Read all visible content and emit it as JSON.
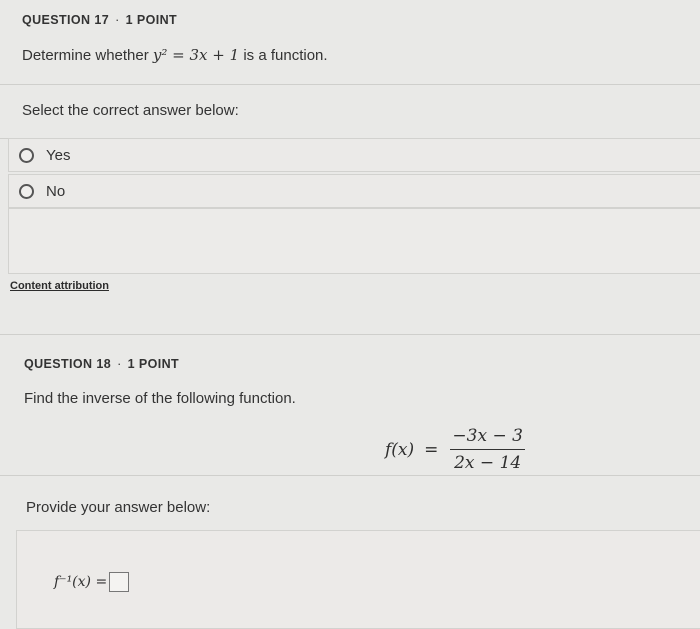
{
  "q17": {
    "number": "QUESTION 17",
    "points": "1 POINT",
    "separator": "·",
    "prompt_before": "Determine whether",
    "equation": "y² = 3x + 1",
    "prompt_after": "is a function.",
    "instruction": "Select the correct answer below:",
    "options": [
      "Yes",
      "No"
    ]
  },
  "attribution": "Content attribution",
  "q18": {
    "number": "QUESTION 18",
    "points": "1 POINT",
    "separator": "·",
    "prompt": "Find the inverse of the following function.",
    "function_lhs": "f(x)",
    "numerator": "−3x − 3",
    "denominator": "2x − 14",
    "answer_prompt": "Provide your answer below:",
    "answer_lhs": "f⁻¹(x) ="
  }
}
